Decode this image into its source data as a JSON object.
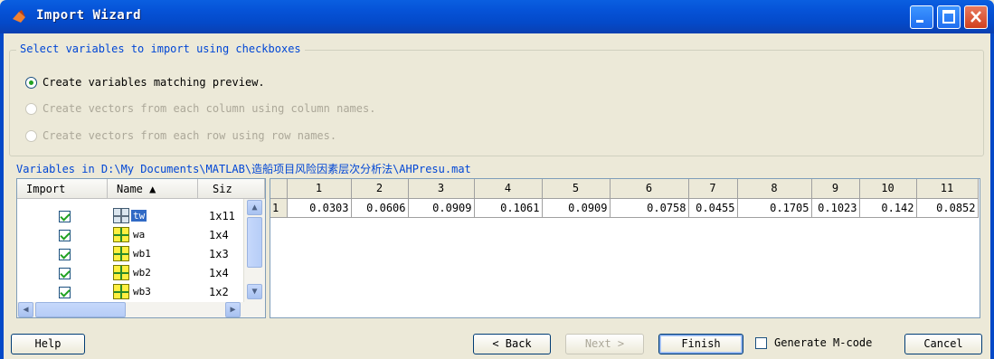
{
  "window": {
    "title": "Import Wizard"
  },
  "options": {
    "legend": "Select variables to import using checkboxes",
    "radios": [
      {
        "label": "Create variables matching preview.",
        "selected": true,
        "enabled": true
      },
      {
        "label": "Create vectors from each column using column names.",
        "selected": false,
        "enabled": false
      },
      {
        "label": "Create vectors from each row using row names.",
        "selected": false,
        "enabled": false
      }
    ]
  },
  "variables": {
    "label": "Variables in D:\\My Documents\\MATLAB\\造船项目风险因素层次分析法\\AHPresu.mat",
    "headers": {
      "import": "Import",
      "name": "Name ▲",
      "size": "Siz"
    },
    "rows": [
      {
        "name": "tw",
        "size": "1x11",
        "checked": true,
        "selected": true
      },
      {
        "name": "wa",
        "size": "1x4",
        "checked": true,
        "selected": false
      },
      {
        "name": "wb1",
        "size": "1x3",
        "checked": true,
        "selected": false
      },
      {
        "name": "wb2",
        "size": "1x4",
        "checked": true,
        "selected": false
      },
      {
        "name": "wb3",
        "size": "1x2",
        "checked": true,
        "selected": false
      }
    ]
  },
  "preview": {
    "columns": [
      "1",
      "2",
      "3",
      "4",
      "5",
      "6",
      "7",
      "8",
      "9",
      "10",
      "11"
    ],
    "rows": [
      {
        "label": "1",
        "values": [
          "0.0303",
          "0.0606",
          "0.0909",
          "0.1061",
          "0.0909",
          "0.0758",
          "0.0455",
          "0.1705",
          "0.1023",
          "0.142",
          "0.0852"
        ]
      }
    ]
  },
  "buttons": {
    "help": "Help",
    "back": "< Back",
    "next": "Next >",
    "finish": "Finish",
    "generate": "Generate M-code",
    "cancel": "Cancel"
  },
  "colors": {
    "titlebar": "#0653d8",
    "link_blue": "#0046d5",
    "selection": "#316ac5",
    "check_green": "#21a121"
  }
}
